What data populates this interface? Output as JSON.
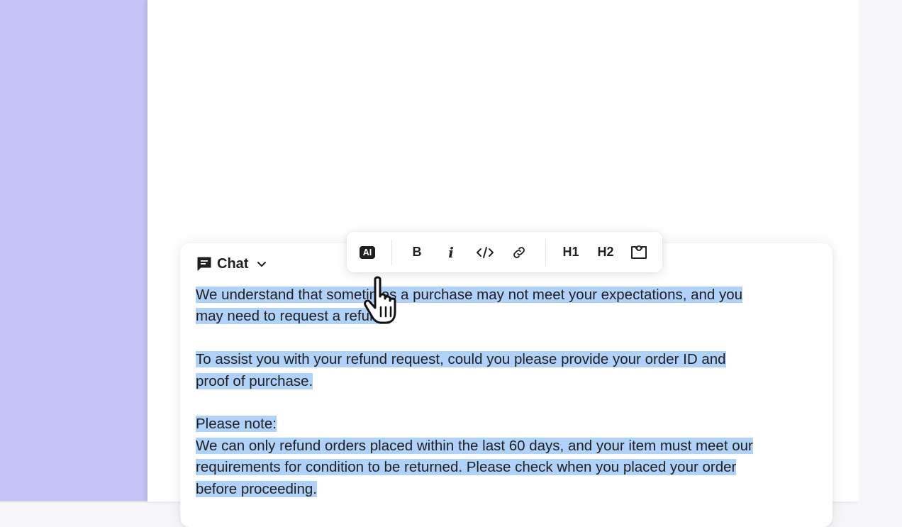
{
  "composer": {
    "channel_label": "Chat",
    "paragraphs": [
      {
        "lines": [
          "We understand that sometimes a purchase may not meet your expectations, and you",
          "may need to request a refund."
        ]
      },
      {
        "lines": [
          "To assist you with your refund request, could you please provide your order ID and",
          "proof of purchase."
        ]
      },
      {
        "lines": [
          "Please note:",
          "We can only refund orders placed within the last 60 days, and your item must meet our",
          "requirements for condition to be returned. Please check when you placed your order",
          "before proceeding."
        ]
      }
    ]
  },
  "toolbar": {
    "ai_label": "AI",
    "bold_label": "B",
    "italic_label": "i",
    "h1_label": "H1",
    "h2_label": "H2"
  },
  "colors": {
    "left_background": "#c3c3f4",
    "selection": "#b1d2f8",
    "text": "#1f1f1f"
  }
}
